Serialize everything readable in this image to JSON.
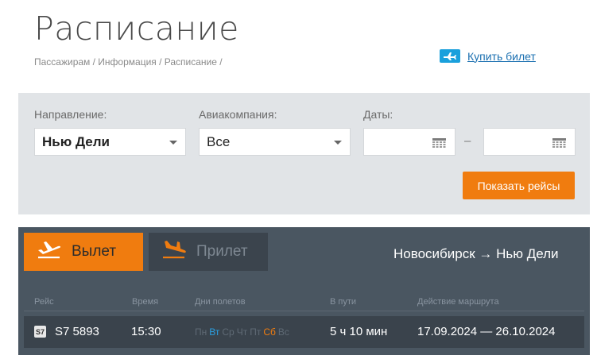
{
  "page": {
    "title": "Расписание",
    "breadcrumb": "Пассажирам / Информация / Расписание /",
    "buy_ticket": "Купить билет"
  },
  "filters": {
    "direction_label": "Направление:",
    "direction_value": "Нью Дели",
    "airline_label": "Авиакомпания:",
    "airline_value": "Все",
    "dates_label": "Даты:",
    "date_from": "",
    "date_to": "",
    "date_separator": "–",
    "show_button": "Показать рейсы"
  },
  "schedule": {
    "tab_departure": "Вылет",
    "tab_arrival": "Прилет",
    "route": "Новосибирск → Нью Дели",
    "columns": {
      "flight": "Рейс",
      "time": "Время",
      "days": "Дни полетов",
      "duration": "В пути",
      "validity": "Действие маршрута"
    },
    "rows": [
      {
        "airline_code": "S7",
        "flight": "S7 5893",
        "time": "15:30",
        "days": {
          "mon": "Пн",
          "tue": "Вт",
          "wed": "Ср",
          "thu": "Чт",
          "fri": "Пт",
          "sat": "Сб",
          "sun": "Вс"
        },
        "duration": "5 ч 10 мин",
        "validity": "17.09.2024 — 26.10.2024"
      }
    ]
  },
  "colors": {
    "accent": "#f07c0f",
    "link": "#1a6fb0",
    "panel_light": "#e1e4e7",
    "panel_dark": "#4a5661"
  }
}
